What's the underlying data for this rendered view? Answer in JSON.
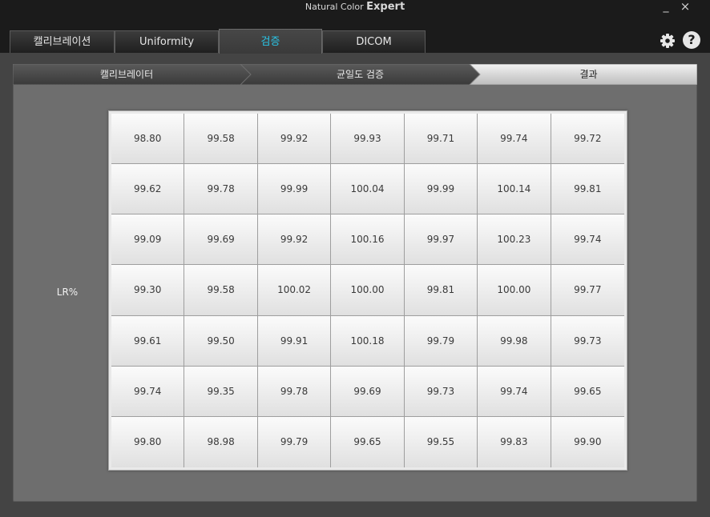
{
  "app": {
    "title_part1": "Natural Color ",
    "title_part2": "Expert"
  },
  "window_controls": {
    "minimize": "_",
    "close": "×"
  },
  "tabs": [
    {
      "label": "캘리브레이션",
      "active": false
    },
    {
      "label": "Uniformity",
      "active": false
    },
    {
      "label": "검증",
      "active": true
    },
    {
      "label": "DICOM",
      "active": false
    }
  ],
  "toolbar": {
    "help_label": "?",
    "settings_icon": "gear-icon"
  },
  "steps": [
    {
      "label": "캘리브레이터",
      "state": "done"
    },
    {
      "label": "균일도 검증",
      "state": "done"
    },
    {
      "label": "결과",
      "state": "current"
    }
  ],
  "result": {
    "row_label": "LR%",
    "grid": [
      [
        "98.80",
        "99.58",
        "99.92",
        "99.93",
        "99.71",
        "99.74",
        "99.72"
      ],
      [
        "99.62",
        "99.78",
        "99.99",
        "100.04",
        "99.99",
        "100.14",
        "99.81"
      ],
      [
        "99.09",
        "99.69",
        "99.92",
        "100.16",
        "99.97",
        "100.23",
        "99.74"
      ],
      [
        "99.30",
        "99.58",
        "100.02",
        "100.00",
        "99.81",
        "100.00",
        "99.77"
      ],
      [
        "99.61",
        "99.50",
        "99.91",
        "100.18",
        "99.79",
        "99.98",
        "99.73"
      ],
      [
        "99.74",
        "99.35",
        "99.78",
        "99.69",
        "99.73",
        "99.74",
        "99.65"
      ],
      [
        "99.80",
        "98.98",
        "99.79",
        "99.65",
        "99.55",
        "99.83",
        "99.90"
      ]
    ]
  },
  "colors": {
    "accent": "#29c6e8",
    "background": "#1b1b1b",
    "panel": "#6e6e6e"
  }
}
